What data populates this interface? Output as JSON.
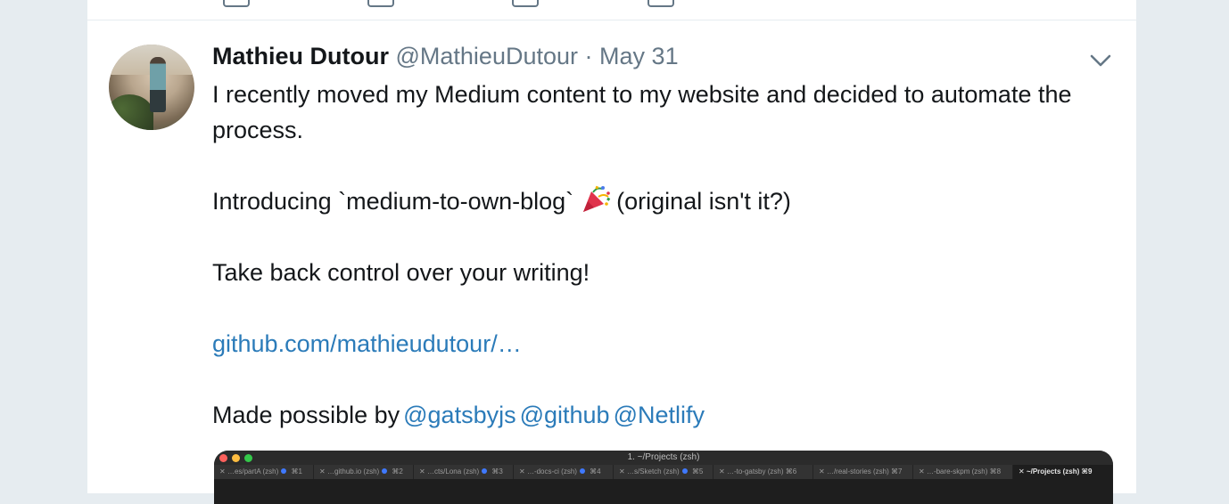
{
  "tweet": {
    "author_name": "Mathieu Dutour",
    "author_handle": "@MathieuDutour",
    "separator": "·",
    "date": "May 31",
    "text_line1": "I recently moved my Medium content to my website and decided to automate the process.",
    "text_intro_before": "Introducing `medium-to-own-blog`",
    "emoji": "party-popper",
    "text_intro_after": "(original isn't it?)",
    "text_take_back": "Take back control over your writing!",
    "link": "github.com/mathieudutour/…",
    "made_possible_prefix": "Made possible by",
    "mentions": [
      "@gatsbyjs",
      "@github",
      "@Netlify"
    ]
  },
  "media": {
    "window_title": "1. ~/Projects (zsh)",
    "tabs": [
      {
        "label": "…es/partA (zsh)",
        "shortcut": "⌘1",
        "dot": true,
        "active": false
      },
      {
        "label": "…github.io (zsh)",
        "shortcut": "⌘2",
        "dot": true,
        "active": false
      },
      {
        "label": "…cts/Lona (zsh)",
        "shortcut": "⌘3",
        "dot": true,
        "active": false
      },
      {
        "label": "…-docs-ci (zsh)",
        "shortcut": "⌘4",
        "dot": true,
        "active": false
      },
      {
        "label": "…s/Sketch (zsh)",
        "shortcut": "⌘5",
        "dot": true,
        "active": false
      },
      {
        "label": "…-to-gatsby (zsh)",
        "shortcut": "⌘6",
        "dot": false,
        "active": false
      },
      {
        "label": "…/real-stories (zsh)",
        "shortcut": "⌘7",
        "dot": false,
        "active": false
      },
      {
        "label": "…-bare-skpm (zsh)",
        "shortcut": "⌘8",
        "dot": false,
        "active": false
      },
      {
        "label": "~/Projects (zsh)",
        "shortcut": "⌘9",
        "dot": false,
        "active": true
      }
    ]
  },
  "colors": {
    "link": "#2b7bb9",
    "secondary_text": "#657786",
    "primary_text": "#14171a",
    "page_background": "#e6ecf0"
  }
}
